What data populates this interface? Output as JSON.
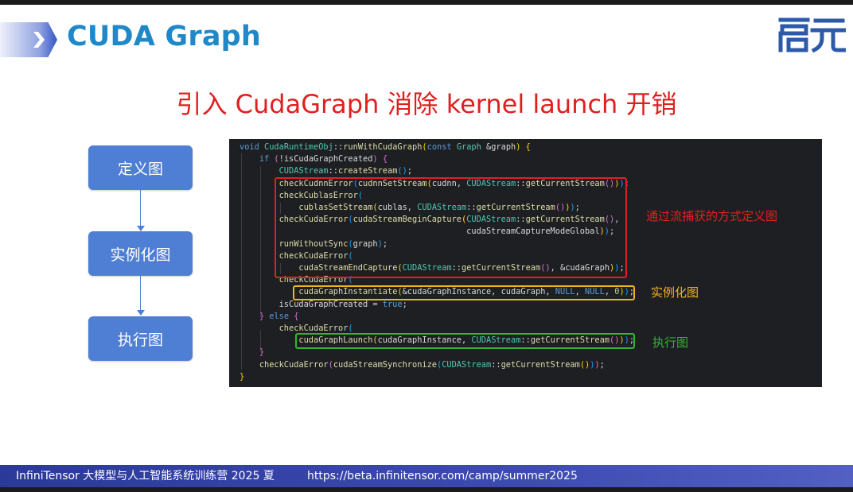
{
  "slide": {
    "title": "CUDA Graph",
    "headline": "引入 CudaGraph 消除 kernel launch 开销",
    "logo_text": "启元"
  },
  "flow": {
    "steps": [
      "定义图",
      "实例化图",
      "执行图"
    ]
  },
  "code_lines": [
    "void CudaRuntimeObj::runWithCudaGraph(const Graph &graph) {",
    "    if (!isCudaGraphCreated) {",
    "        CUDAStream::createStream();",
    "        checkCudnnError(cudnnSetStream(cudnn, CUDAStream::getCurrentStream()));",
    "        checkCublasError(",
    "            cublasSetStream(cublas, CUDAStream::getCurrentStream()));",
    "        checkCudaError(cudaStreamBeginCapture(CUDAStream::getCurrentStream(),",
    "                                              cudaStreamCaptureModeGlobal));",
    "        runWithoutSync(graph);",
    "        checkCudaError(",
    "            cudaStreamEndCapture(CUDAStream::getCurrentStream(), &cudaGraph));",
    "        checkCudaError(",
    "            cudaGraphInstantiate(&cudaGraphInstance, cudaGraph, NULL, NULL, 0));",
    "        isCudaGraphCreated = true;",
    "    } else {",
    "        checkCudaError(",
    "            cudaGraphLaunch(cudaGraphInstance, CUDAStream::getCurrentStream()));",
    "    }",
    "    checkCudaError(cudaStreamSynchronize(CUDAStream::getCurrentStream()));",
    "}"
  ],
  "annotations": {
    "capture": "通过流捕获的方式定义图",
    "instantiate": "实例化图",
    "launch": "执行图"
  },
  "colors": {
    "title": "#1e88c8",
    "headline": "#e02020",
    "flow_box": "#4f7fd4",
    "capture_box": "#e02020",
    "instantiate_box": "#f2b21c",
    "launch_box": "#2eb82e",
    "footer": "#3d4ab0"
  },
  "footer": {
    "program": "InfiniTensor 大模型与人工智能系统训练营 2025 夏",
    "url": "https://beta.infinitensor.com/camp/summer2025"
  }
}
